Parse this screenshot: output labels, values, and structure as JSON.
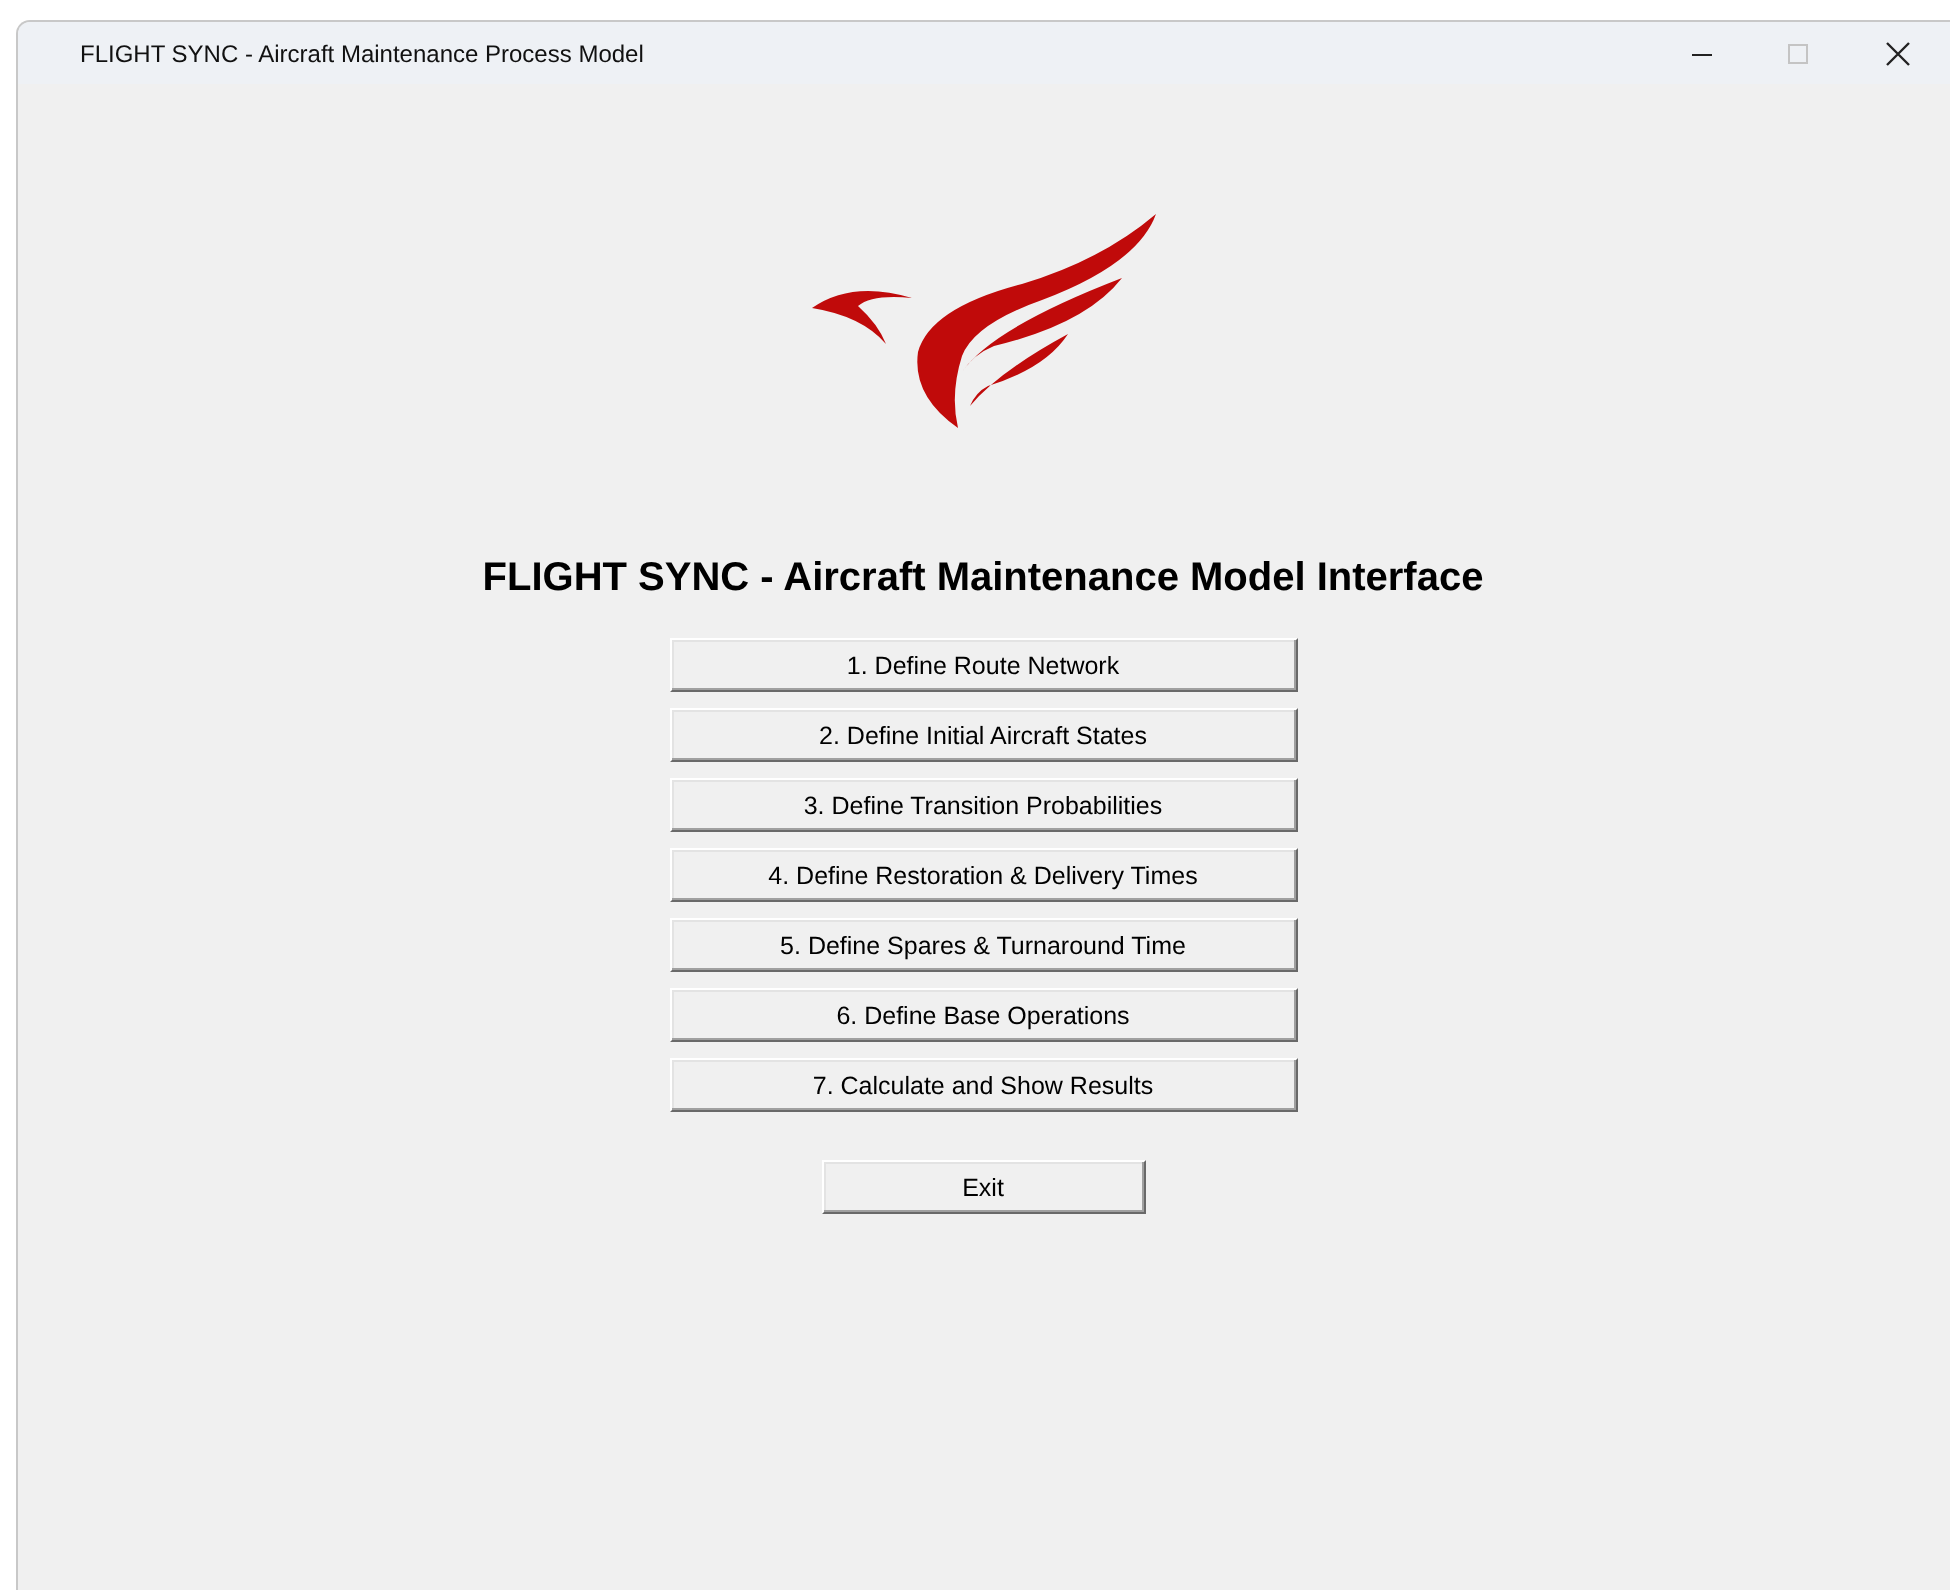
{
  "window": {
    "title": "FLIGHT SYNC - Aircraft Maintenance Process Model",
    "controls": [
      {
        "kind": "minimize"
      },
      {
        "kind": "maximize",
        "disabled": true
      },
      {
        "kind": "close"
      }
    ]
  },
  "heading": "FLIGHT SYNC - Aircraft Maintenance Model Interface",
  "menu_buttons": [
    "1. Define Route Network",
    "2. Define Initial Aircraft States",
    "3. Define Transition Probabilities",
    "4. Define Restoration & Delivery Times",
    "5. Define Spares & Turnaround Time",
    "6. Define Base Operations",
    "7. Calculate and Show Results"
  ],
  "exit_button": "Exit"
}
